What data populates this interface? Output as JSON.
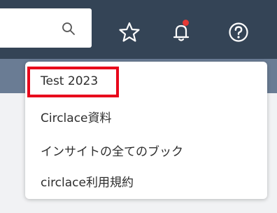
{
  "header": {
    "search_icon": "search-icon",
    "actions": [
      {
        "icon": "star-icon"
      },
      {
        "icon": "bell-icon",
        "has_notification": true
      },
      {
        "icon": "help-icon"
      }
    ],
    "notification_dot_color": "#e53935"
  },
  "menu": {
    "items": [
      {
        "label": "Test 2023",
        "highlighted": true
      },
      {
        "label": "Circlace資料"
      },
      {
        "label": "インサイトの全てのブック"
      },
      {
        "label": "circlace利用規約"
      }
    ],
    "highlight_color": "#e8061b"
  }
}
